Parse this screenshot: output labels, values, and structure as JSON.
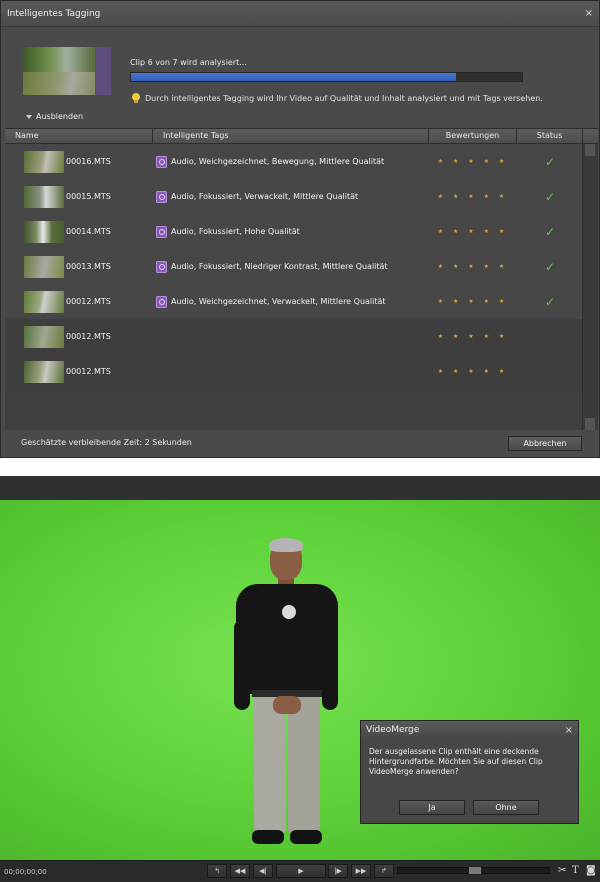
{
  "tagging_dialog": {
    "title": "Intelligentes Tagging",
    "close": "×",
    "status": "Clip 6 von 7 wird analysiert...",
    "progress": 0.83,
    "hint": "Durch intelligentes Tagging wird Ihr Video auf Qualität und Inhalt analysiert und mit Tags versehen.",
    "toggle_label": "Ausblenden",
    "columns": {
      "name": "Name",
      "tags": "Intelligente Tags",
      "rating": "Bewertungen",
      "status": "Status"
    },
    "rows": [
      {
        "name": "00016.MTS",
        "tags": "Audio, Weichgezeichnet, Bewegung, Mittlere Qualität",
        "stars": "★ ★ ★ ★ ★",
        "status": "✓"
      },
      {
        "name": "00015.MTS",
        "tags": "Audio, Fokussiert, Verwackelt, Mittlere Qualität",
        "stars": "★ ★ ★ ★ ★",
        "status": "✓"
      },
      {
        "name": "00014.MTS",
        "tags": "Audio, Fokussiert, Hohe Qualität",
        "stars": "★ ★ ★ ★ ★",
        "status": "✓"
      },
      {
        "name": "00013.MTS",
        "tags": "Audio, Fokussiert, Niedriger Kontrast, Mittlere Qualität",
        "stars": "★ ★ ★ ★ ★",
        "status": "✓"
      },
      {
        "name": "00012.MTS",
        "tags": "Audio, Weichgezeichnet, Verwackelt, Mittlere Qualität",
        "stars": "★ ★ ★ ★ ★",
        "status": "✓"
      },
      {
        "name": "00012.MTS",
        "tags": "",
        "stars": "★ ★ ★ ★ ★",
        "status": ""
      },
      {
        "name": "00012.MTS",
        "tags": "",
        "stars": "★ ★ ★ ★ ★",
        "status": ""
      }
    ],
    "eta": "Geschätzte verbleibende Zeit: 2 Sekunden",
    "cancel": "Abbrechen"
  },
  "video_monitor": {
    "dialog": {
      "title": "VideoMerge",
      "close": "×",
      "message": "Der ausgelassene Clip enthält eine deckende Hintergrundfarbe. Möchten Sie auf diesen Clip VideoMerge anwenden?",
      "yes": "Ja",
      "no": "Ohne"
    },
    "timecode": "00;00;00;00",
    "transport": {
      "go_start": "↰",
      "rewind": "◀◀",
      "step_back": "◀|",
      "play": "▶",
      "step_forward": "|▶",
      "fast_forward": "▶▶",
      "go_end": "↱"
    },
    "tools": {
      "scissors": "✂",
      "text": "T",
      "camera": "◙"
    },
    "colors": {
      "green_screen": "#5fd43a",
      "progress_blue": "#3a6acb",
      "star_gold": "#d8a63a",
      "check_green": "#6cc24a"
    }
  }
}
